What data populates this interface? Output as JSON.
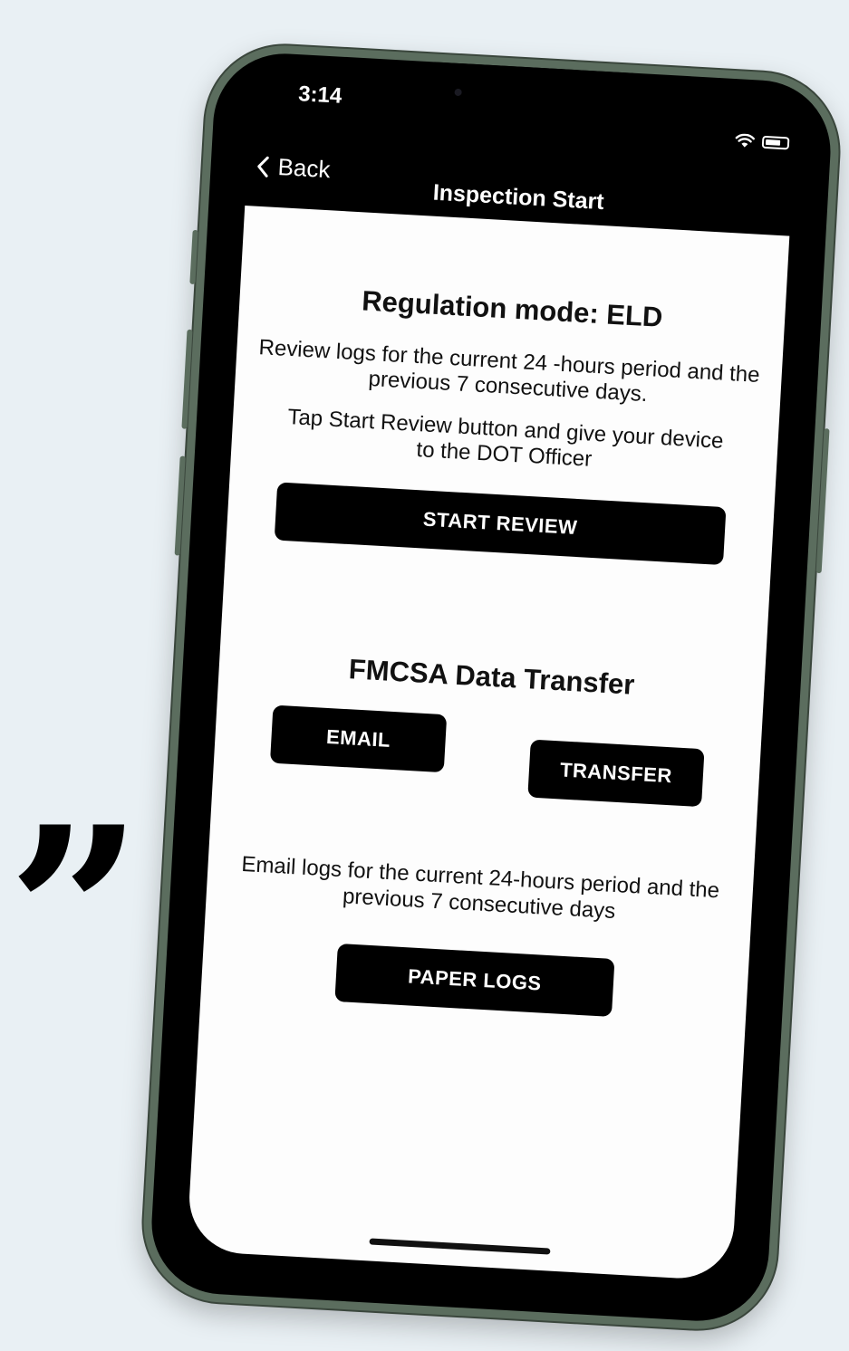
{
  "decor": {
    "quote_mark": "”"
  },
  "status": {
    "time": "3:14"
  },
  "nav": {
    "back_label": "Back",
    "title": "Inspection Start"
  },
  "regulation": {
    "heading": "Regulation mode: ELD",
    "description": "Review logs for the current 24 -hours period and the previous 7 consecutive days.",
    "instruction": "Tap Start Review button and give your device to the DOT Officer",
    "start_review_label": "START REVIEW"
  },
  "transfer": {
    "heading": "FMCSA Data Transfer",
    "email_label": "EMAIL",
    "transfer_label": "TRANSFER",
    "description": "Email logs for the current 24-hours period and the previous 7 consecutive days",
    "paper_logs_label": "PAPER LOGS"
  },
  "colors": {
    "background": "#e9f0f4",
    "frame": "#5b6d5e",
    "button": "#000000",
    "screen": "#fdfdfd"
  }
}
